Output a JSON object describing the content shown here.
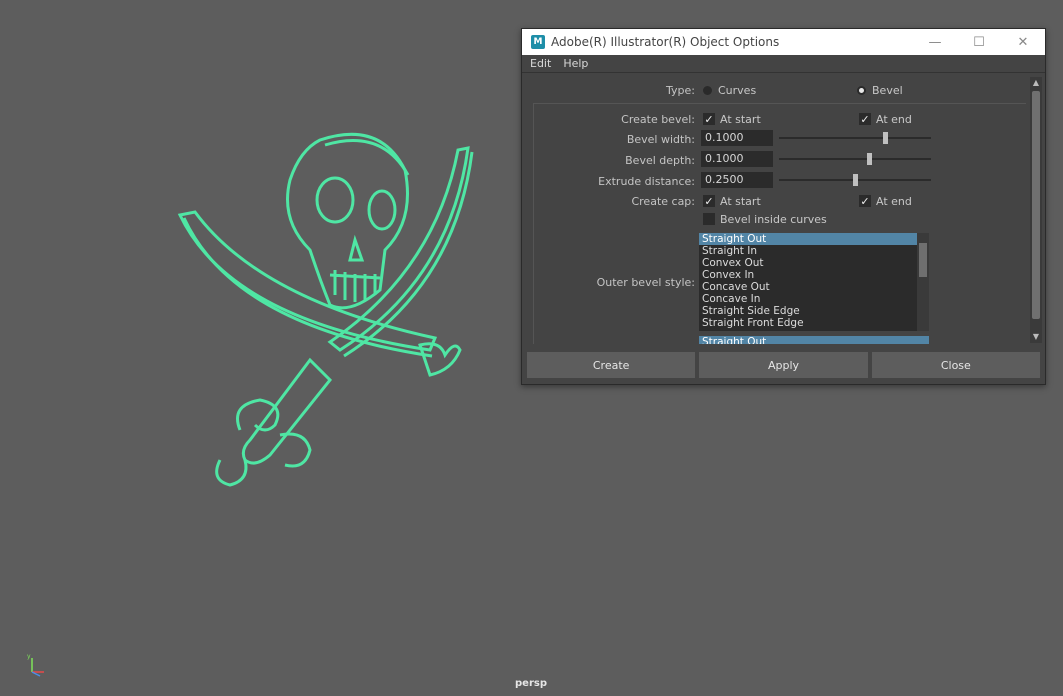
{
  "viewport": {
    "camera": "persp"
  },
  "dialog": {
    "title": "Adobe(R) Illustrator(R) Object Options",
    "app_icon": "M",
    "menu": [
      "Edit",
      "Help"
    ],
    "type_label": "Type:",
    "type_options": [
      {
        "label": "Curves",
        "selected": false
      },
      {
        "label": "Bevel",
        "selected": true
      }
    ],
    "create_bevel_label": "Create bevel:",
    "create_bevel": {
      "at_start": "At start",
      "at_end": "At end"
    },
    "bevel_width_label": "Bevel width:",
    "bevel_width": "0.1000",
    "bevel_depth_label": "Bevel depth:",
    "bevel_depth": "0.1000",
    "extrude_distance_label": "Extrude distance:",
    "extrude_distance": "0.2500",
    "create_cap_label": "Create cap:",
    "create_cap": {
      "at_start": "At start",
      "at_end": "At end"
    },
    "bevel_inside_curves": "Bevel inside curves",
    "outer_bevel_style_label": "Outer bevel style:",
    "outer_bevel_styles": [
      "Straight Out",
      "Straight In",
      "Convex Out",
      "Convex In",
      "Concave Out",
      "Concave In",
      "Straight Side Edge",
      "Straight Front Edge"
    ],
    "outer_bevel_selected": "Straight Out",
    "partial_next": "Straight Out",
    "buttons": {
      "create": "Create",
      "apply": "Apply",
      "close": "Close"
    }
  }
}
